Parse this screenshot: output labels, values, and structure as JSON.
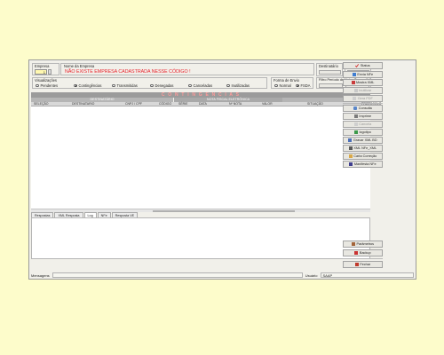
{
  "header": {
    "empresa": {
      "label": "Empresa",
      "value": "1"
    },
    "nome_empresa": {
      "label": "Nome da Empresa",
      "value": "NÃO EXISTE EMPRESA CADASTRADA NESSE CÓDIGO !"
    },
    "destinatario": {
      "label": "Destinatário",
      "value": ""
    },
    "numero_nota": {
      "label": "Nº da Nota",
      "value": ""
    }
  },
  "visualizacoes": {
    "label": "Visualizações",
    "options": [
      "Pendentes",
      "Contingências",
      "Transmitidas",
      "Denegadas",
      "Canceladas",
      "Inutilizadas"
    ],
    "selected": "Contingências"
  },
  "forma_envio": {
    "label": "Forma de Envio",
    "options": [
      "Normal",
      "FSDA"
    ],
    "selected": "FSDA"
  },
  "filtro_periodo": {
    "label": "Filtro Período de Notas Transmitidas",
    "inicio": "",
    "fim": ""
  },
  "banner": "C O N T I N G E N C I A S",
  "grid": {
    "groups": [
      "DESTINATÁRIO",
      "NOTA FISCAL ELETRÔNICA"
    ],
    "columns": [
      "SELEÇÃO",
      "DESTINATARIO",
      "CNPJ / CPF",
      "CÓDIGO",
      "SÉRIE",
      "DATA",
      "Nº NOTA",
      "VALOR",
      "SITUAÇÃO",
      "PROTOCOLO"
    ]
  },
  "tabs": [
    "Respostas",
    "XML Resposta",
    "Log",
    "NFe",
    "Resposta VE"
  ],
  "active_tab": "Log",
  "buttons": {
    "status": "Status",
    "envia_nfe": "Envia NFe",
    "mostra_xml": "Mostra XML",
    "inutilizar": "Inutilizar",
    "gera_pdf": "Gera PDF",
    "consulta": "Consulta",
    "imprime": "Imprime",
    "cancela": "Cancela",
    "logotipo": "logotipo",
    "gravar_xml_bd": "Gravar XML BD",
    "xml_nfe_xml": "XML NFe_XML",
    "carta_correcao": "Carta Correção",
    "manifesta_nfe": "Manifesta NFe",
    "parametros": "Parâmetros",
    "backup": "Backup",
    "fechar": "Fechar"
  },
  "statusbar": {
    "mensagens_label": "Mensagens",
    "mensagens_value": "",
    "usuario_label": "Usuário",
    "usuario_value": "SAAP"
  },
  "colors": {
    "background": "#fdfccb",
    "window": "#f1f0ea",
    "error_text": "#e8202a",
    "banner_bg": "#9b9b9b",
    "banner_text": "#ff9a9a"
  }
}
